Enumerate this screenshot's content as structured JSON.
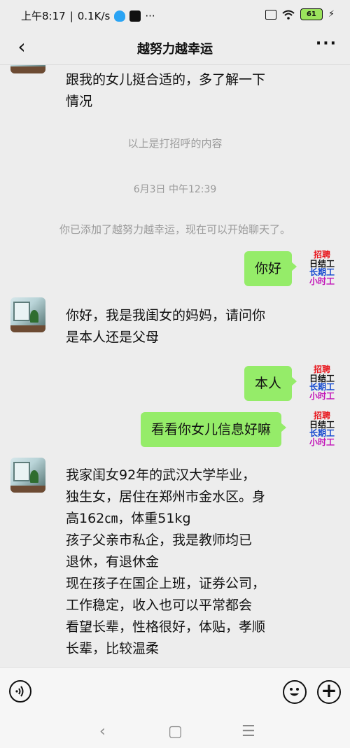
{
  "status": {
    "time": "上午8:17",
    "speed": "0.1K/s",
    "battery": "61",
    "dots": "···"
  },
  "header": {
    "back": "‹",
    "title": "越努力越幸运",
    "more": "···"
  },
  "messages": {
    "partial_incoming": "跟我的女儿挺合适的，多了解一下\n情况",
    "greeting_note": "以上是打招呼的内容",
    "date": "6月3日 中午12:39",
    "added_note": "你已添加了越努力越幸运，现在可以开始聊天了。",
    "out1": "你好",
    "in1": "你好，我是我闺女的妈妈，请问你\n是本人还是父母",
    "out2": "本人",
    "out3": "看看你女儿信息好嘛",
    "in2": "我家闺女92年的武汉大学毕业，\n独生女，居住在郑州市金水区。身\n高162㎝，体重51kg\n孩子父亲市私企，我是教师均已\n退休，有退休金\n现在孩子在国企上班，证券公司，\n工作稳定，收入也可以平常都会\n看望长辈，性格很好，体贴，孝顺\n长辈，比较温柔"
  },
  "badge": {
    "line1": "招聘",
    "line2": "日结工",
    "line3": "长期工",
    "line4": "小时工"
  },
  "nav": {
    "back": "‹",
    "home": "▢",
    "menu": "☰"
  },
  "colors": {
    "bubble_out": "#95ec69",
    "background": "#ededed"
  }
}
